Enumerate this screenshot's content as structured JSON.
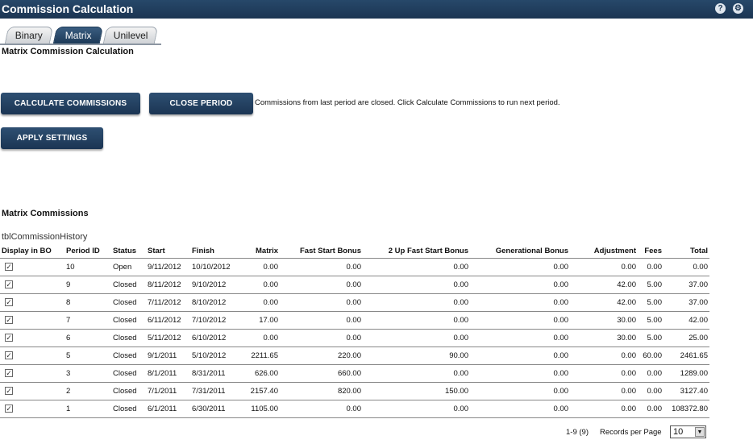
{
  "titlebar": {
    "title": "Commission Calculation",
    "help_icon": "?",
    "settings_icon": "⚙"
  },
  "tabs": [
    {
      "label": "Binary",
      "active": false
    },
    {
      "label": "Matrix",
      "active": true
    },
    {
      "label": "Unilevel",
      "active": false
    }
  ],
  "page": {
    "section_title": "Matrix Commission Calculation",
    "buttons": {
      "calculate": "CALCULATE COMMISSIONS",
      "close_period": "CLOSE PERIOD",
      "apply_settings": "APPLY SETTINGS"
    },
    "status_message": "Commissions from last period are closed. Click Calculate Commissions to run next period."
  },
  "commissions": {
    "heading": "Matrix Commissions",
    "table_caption": "tblCommissionHistory",
    "columns": [
      "Display in BO",
      "Period ID",
      "Status",
      "Start",
      "Finish",
      "Matrix",
      "Fast Start Bonus",
      "2 Up Fast Start Bonus",
      "Generational Bonus",
      "Adjustment",
      "Fees",
      "Total"
    ],
    "rows": [
      {
        "display": true,
        "period_id": "10",
        "status": "Open",
        "start": "9/11/2012",
        "finish": "10/10/2012",
        "matrix": "0.00",
        "fast_start": "0.00",
        "two_up": "0.00",
        "generational": "0.00",
        "adjustment": "0.00",
        "fees": "0.00",
        "total": "0.00"
      },
      {
        "display": true,
        "period_id": "9",
        "status": "Closed",
        "start": "8/11/2012",
        "finish": "9/10/2012",
        "matrix": "0.00",
        "fast_start": "0.00",
        "two_up": "0.00",
        "generational": "0.00",
        "adjustment": "42.00",
        "fees": "5.00",
        "total": "37.00"
      },
      {
        "display": true,
        "period_id": "8",
        "status": "Closed",
        "start": "7/11/2012",
        "finish": "8/10/2012",
        "matrix": "0.00",
        "fast_start": "0.00",
        "two_up": "0.00",
        "generational": "0.00",
        "adjustment": "42.00",
        "fees": "5.00",
        "total": "37.00"
      },
      {
        "display": true,
        "period_id": "7",
        "status": "Closed",
        "start": "6/11/2012",
        "finish": "7/10/2012",
        "matrix": "17.00",
        "fast_start": "0.00",
        "two_up": "0.00",
        "generational": "0.00",
        "adjustment": "30.00",
        "fees": "5.00",
        "total": "42.00"
      },
      {
        "display": true,
        "period_id": "6",
        "status": "Closed",
        "start": "5/11/2012",
        "finish": "6/10/2012",
        "matrix": "0.00",
        "fast_start": "0.00",
        "two_up": "0.00",
        "generational": "0.00",
        "adjustment": "30.00",
        "fees": "5.00",
        "total": "25.00"
      },
      {
        "display": true,
        "period_id": "5",
        "status": "Closed",
        "start": "9/1/2011",
        "finish": "5/10/2012",
        "matrix": "2211.65",
        "fast_start": "220.00",
        "two_up": "90.00",
        "generational": "0.00",
        "adjustment": "0.00",
        "fees": "60.00",
        "total": "2461.65"
      },
      {
        "display": true,
        "period_id": "3",
        "status": "Closed",
        "start": "8/1/2011",
        "finish": "8/31/2011",
        "matrix": "626.00",
        "fast_start": "660.00",
        "two_up": "0.00",
        "generational": "0.00",
        "adjustment": "0.00",
        "fees": "0.00",
        "total": "1289.00"
      },
      {
        "display": true,
        "period_id": "2",
        "status": "Closed",
        "start": "7/1/2011",
        "finish": "7/31/2011",
        "matrix": "2157.40",
        "fast_start": "820.00",
        "two_up": "150.00",
        "generational": "0.00",
        "adjustment": "0.00",
        "fees": "0.00",
        "total": "3127.40"
      },
      {
        "display": true,
        "period_id": "1",
        "status": "Closed",
        "start": "6/1/2011",
        "finish": "6/30/2011",
        "matrix": "1105.00",
        "fast_start": "0.00",
        "two_up": "0.00",
        "generational": "0.00",
        "adjustment": "0.00",
        "fees": "0.00",
        "total": "108372.80"
      }
    ],
    "pager": "1-9 (9)",
    "records_per_page_label": "Records per Page",
    "records_per_page_value": "10"
  }
}
